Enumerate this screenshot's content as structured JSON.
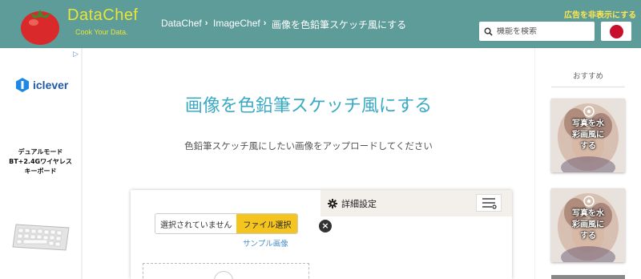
{
  "header": {
    "brand": "DataChef",
    "tagline": "Cook Your Data.",
    "breadcrumbs": [
      {
        "label": "DataChef"
      },
      {
        "label": "ImageChef"
      },
      {
        "label": "画像を色鉛筆スケッチ風にする"
      }
    ],
    "hide_ads_label": "広告を非表示にする",
    "search_placeholder": "機能を検索",
    "language_flag": "japan-flag-icon"
  },
  "left_ad": {
    "badge": "▷",
    "brand": "iclever",
    "copy_lines": [
      "デュアルモード",
      "BT+2.4Gワイヤレス",
      "キーボード"
    ]
  },
  "main": {
    "title": "画像を色鉛筆スケッチ風にする",
    "subtitle": "色鉛筆スケッチ風にしたい画像をアップロードしてください",
    "file_status": "選択されていません",
    "file_button": "ファイル選択",
    "sample_link": "サンプル画像",
    "settings_label": "詳細設定",
    "close_glyph": "×"
  },
  "sidebar": {
    "recommend_title": "おすすめ",
    "items": [
      {
        "caption_lines": [
          "写真を水",
          "彩画風に",
          "する"
        ]
      },
      {
        "caption_lines": [
          "写真を水",
          "彩画風に",
          "する"
        ]
      }
    ]
  },
  "colors": {
    "header_bg": "#5e9c99",
    "brand_yellow": "#e8e43a",
    "title_blue": "#3aa9c4",
    "file_button": "#f5c51f"
  }
}
